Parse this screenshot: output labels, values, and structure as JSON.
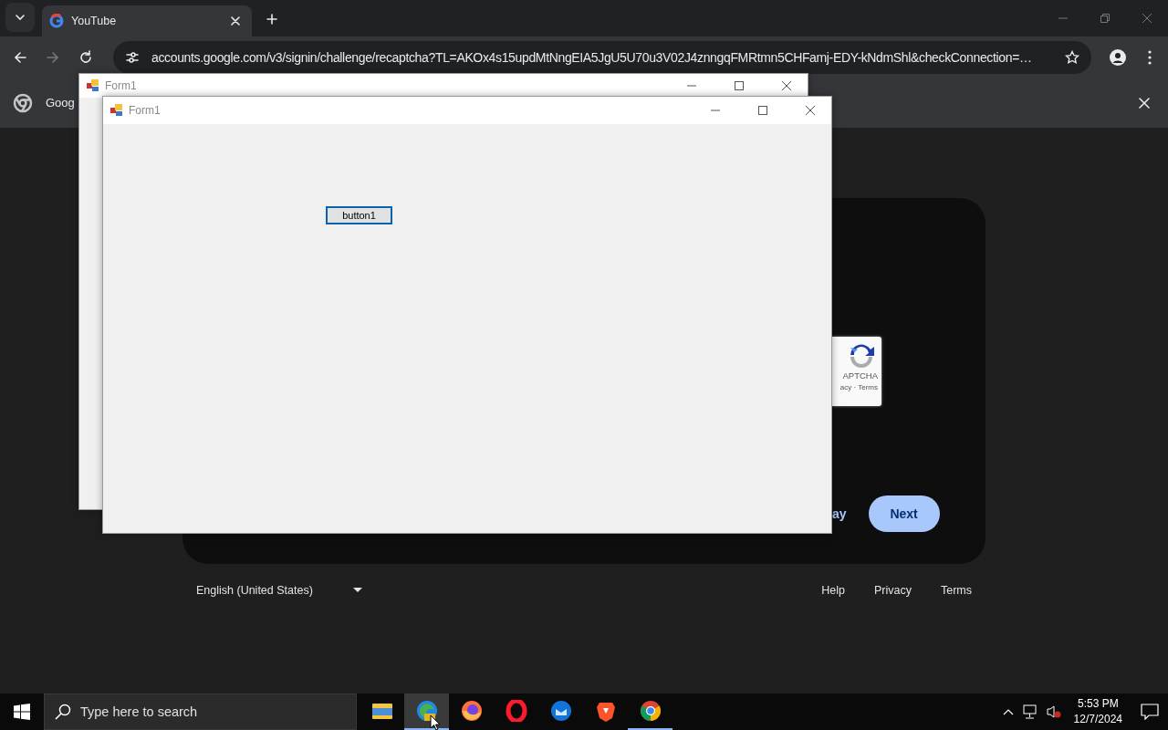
{
  "browser": {
    "tabs": [
      {
        "title": "YouTube",
        "selected": true
      }
    ],
    "url": "accounts.google.com/v3/signin/challenge/recaptcha?TL=AKOx4s15updMtNngEIA5JgU5U70u3V02J4znngqFMRtmn5CHFamj-EDY-kNdmShl&checkConnection=…",
    "infobar": {
      "text": "Goog"
    }
  },
  "page": {
    "recaptcha": {
      "label": "APTCHA",
      "links": "acy · Terms"
    },
    "secondary_button": "ay",
    "next_button": "Next",
    "footer": {
      "language": "English (United States)",
      "links": [
        "Help",
        "Privacy",
        "Terms"
      ]
    }
  },
  "windows": [
    {
      "title": "Form1"
    },
    {
      "title": "Form1",
      "button": {
        "label": "button1",
        "focused": true
      }
    }
  ],
  "taskbar": {
    "search_placeholder": "Type here to search",
    "apps": [
      {
        "kind": "folder",
        "running": false,
        "selected": false
      },
      {
        "kind": "edge",
        "running": true,
        "selected": true
      },
      {
        "kind": "firefox",
        "running": false,
        "selected": false
      },
      {
        "kind": "opera",
        "running": false,
        "selected": false
      },
      {
        "kind": "thunderbird",
        "running": false,
        "selected": false
      },
      {
        "kind": "brave",
        "running": false,
        "selected": false
      },
      {
        "kind": "chrome",
        "running": true,
        "selected": false
      }
    ],
    "time": "5:53 PM",
    "date": "12/7/2024"
  }
}
